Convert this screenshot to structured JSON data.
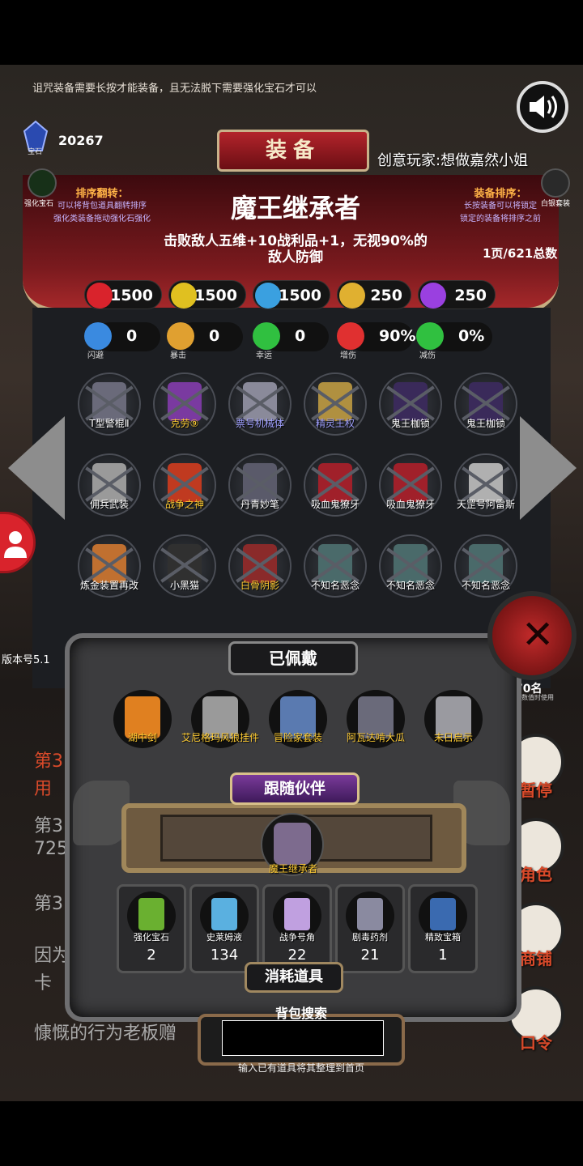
{
  "notice": "诅咒装备需要长按才能装备，且无法脱下需要强化宝石才可以",
  "gems": {
    "count": "20267",
    "label": "宝石"
  },
  "header": {
    "title": "装备",
    "creator": "创意玩家:想做嘉然小姐"
  },
  "left_side_label": "强化宝石",
  "right_side_label": "白银套装",
  "sort_left": {
    "title": "排序翻转：",
    "lines": [
      "可以将背包道具翻转排序",
      "强化类装备拖动强化石强化"
    ]
  },
  "sort_right": {
    "title": "装备排序：",
    "lines": [
      "长按装备可以将锁定",
      "锁定的装备将排序之前"
    ]
  },
  "item": {
    "name": "魔王继承者",
    "desc_line1": "击败敌人五维+10战利品+1，无视90%的",
    "desc_line2": "敌人防御"
  },
  "page_info": "1页/621总数",
  "stats_main": [
    {
      "icon": "heart-icon",
      "value": "1500",
      "color": "#d9232c"
    },
    {
      "icon": "muscle-icon",
      "value": "1500",
      "color": "#e0c020"
    },
    {
      "icon": "helmet-icon",
      "value": "1500",
      "color": "#3aa0e0"
    },
    {
      "icon": "sword-icon",
      "value": "250",
      "color": "#e0b030"
    },
    {
      "icon": "lightning-icon",
      "value": "250",
      "color": "#9a40e0"
    }
  ],
  "stats_sub": [
    {
      "icon": "dodge-icon",
      "value": "0",
      "label": "闪避",
      "color": "#3a8ae0"
    },
    {
      "icon": "crit-icon",
      "value": "0",
      "label": "暴击",
      "color": "#e0a030"
    },
    {
      "icon": "clover-icon",
      "value": "0",
      "label": "幸运",
      "color": "#30c040"
    },
    {
      "icon": "crossed-swords-icon",
      "value": "90%",
      "label": "增伤",
      "color": "#e03030"
    },
    {
      "icon": "shield-icon",
      "value": "0%",
      "label": "减伤",
      "color": "#30c040"
    }
  ],
  "grid_items": [
    {
      "label": "T型警棍Ⅱ",
      "color": "#6a6a7a",
      "label_color": "#ffffff"
    },
    {
      "label": "克劳⑨",
      "color": "#7a3aa0",
      "label_color": "#ffcc33"
    },
    {
      "label": "票号机械体",
      "color": "#8a8a9a",
      "label_color": "#a0a0ff"
    },
    {
      "label": "精灵王权",
      "color": "#b09040",
      "label_color": "#a0a0ff"
    },
    {
      "label": "鬼王枷锁",
      "color": "#3a2a5a",
      "label_color": "#ffffff"
    },
    {
      "label": "鬼王枷锁",
      "color": "#3a2a5a",
      "label_color": "#ffffff"
    },
    {
      "label": "佣兵武装",
      "color": "#9a9a9a",
      "label_color": "#ffffff"
    },
    {
      "label": "战争之神",
      "color": "#c03a20",
      "label_color": "#ffcc33"
    },
    {
      "label": "丹青妙笔",
      "color": "#5a5a6a",
      "label_color": "#ffffff"
    },
    {
      "label": "吸血鬼獠牙",
      "color": "#a0202a",
      "label_color": "#ffffff"
    },
    {
      "label": "吸血鬼獠牙",
      "color": "#a0202a",
      "label_color": "#ffffff"
    },
    {
      "label": "天罡号阿雷斯",
      "color": "#b0b0b0",
      "label_color": "#ffffff"
    },
    {
      "label": "炼金装置再改",
      "color": "#c07030",
      "label_color": "#ffffff"
    },
    {
      "label": "小黑猫",
      "color": "#303030",
      "label_color": "#ffffff"
    },
    {
      "label": "白骨阴影",
      "color": "#8a2a2a",
      "label_color": "#ffcc33"
    },
    {
      "label": "不知名恶念",
      "color": "#4a6a6a",
      "label_color": "#ffffff"
    },
    {
      "label": "不知名恶念",
      "color": "#4a6a6a",
      "label_color": "#ffffff"
    },
    {
      "label": "不知名恶念",
      "color": "#4a6a6a",
      "label_color": "#ffffff"
    }
  ],
  "version": "版本号5.1",
  "used": {
    "count": "70名",
    "sub": "真数值时使用"
  },
  "right_menu": [
    {
      "icon": "dice-icon",
      "label": "暂停"
    },
    {
      "icon": "hooded-figure-icon",
      "label": "角色"
    },
    {
      "icon": "shop-icon",
      "label": "商铺"
    },
    {
      "icon": "scroll-icon",
      "label": "口令"
    }
  ],
  "bg_lines": [
    {
      "text": "第3",
      "red": true
    },
    {
      "text": "用",
      "red": true
    },
    {
      "text": "第3",
      "red": false
    },
    {
      "text": "725",
      "red": false
    },
    {
      "text": "第3",
      "red": false
    },
    {
      "text": "因为",
      "red": false
    },
    {
      "text": "卡",
      "red": false
    },
    {
      "text": "慷慨的行为老板赠",
      "red": false
    }
  ],
  "equipped": {
    "title": "已佩戴",
    "items": [
      {
        "label": "湖中剑",
        "color": "#e08020"
      },
      {
        "label": "艾尼格玛风狼挂件",
        "color": "#9a9a9a"
      },
      {
        "label": "冒险家套装",
        "color": "#5a7ab0"
      },
      {
        "label": "阿瓦达啃大瓜",
        "color": "#6a6a7a"
      },
      {
        "label": "末日启示",
        "color": "#9a9aa0"
      }
    ]
  },
  "partner": {
    "title": "跟随伙伴",
    "name": "魔王继承者"
  },
  "consumables": {
    "title": "消耗道具",
    "items": [
      {
        "label": "强化宝石",
        "count": "2",
        "color": "#6ab030"
      },
      {
        "label": "史莱姆液",
        "count": "134",
        "color": "#5ab0e0"
      },
      {
        "label": "战争号角",
        "count": "22",
        "color": "#c0a0e0"
      },
      {
        "label": "剧毒药剂",
        "count": "21",
        "color": "#8a8aa0"
      },
      {
        "label": "精致宝箱",
        "count": "1",
        "color": "#3a6ab0"
      }
    ]
  },
  "search": {
    "label": "背包搜索",
    "value": "",
    "placeholder": "",
    "hint": "输入已有道具将其整理到首页"
  }
}
